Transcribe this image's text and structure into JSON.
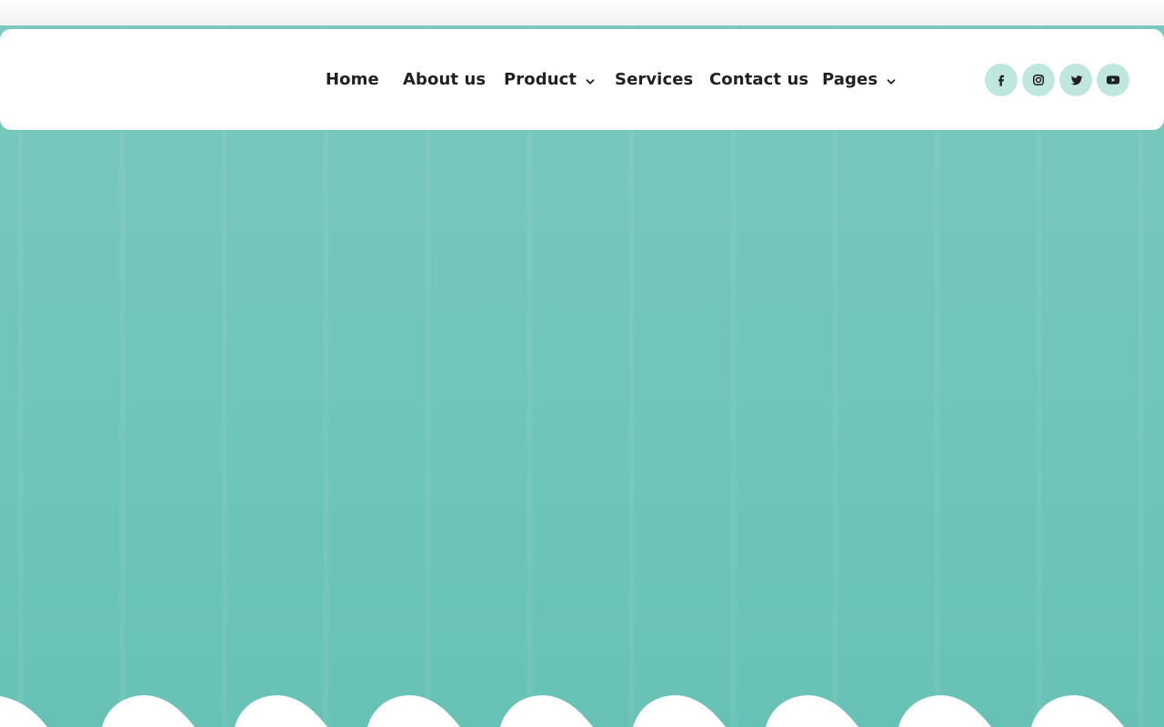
{
  "nav": {
    "items": [
      {
        "label": "Home",
        "has_dropdown": false
      },
      {
        "label": "About us",
        "has_dropdown": false
      },
      {
        "label": "Product",
        "has_dropdown": true
      },
      {
        "label": "Services",
        "has_dropdown": false
      },
      {
        "label": "Contact us",
        "has_dropdown": false
      },
      {
        "label": "Pages",
        "has_dropdown": true
      }
    ]
  },
  "social": {
    "items": [
      {
        "name": "facebook",
        "icon": "facebook-icon"
      },
      {
        "name": "instagram",
        "icon": "instagram-icon"
      },
      {
        "name": "twitter",
        "icon": "twitter-icon"
      },
      {
        "name": "youtube",
        "icon": "youtube-icon"
      }
    ]
  },
  "colors": {
    "hero_teal_top": "#78c8bd",
    "hero_teal_bottom": "#67c2b5",
    "nav_text": "#202124",
    "social_bg": "#bfe6df",
    "white": "#ffffff"
  }
}
